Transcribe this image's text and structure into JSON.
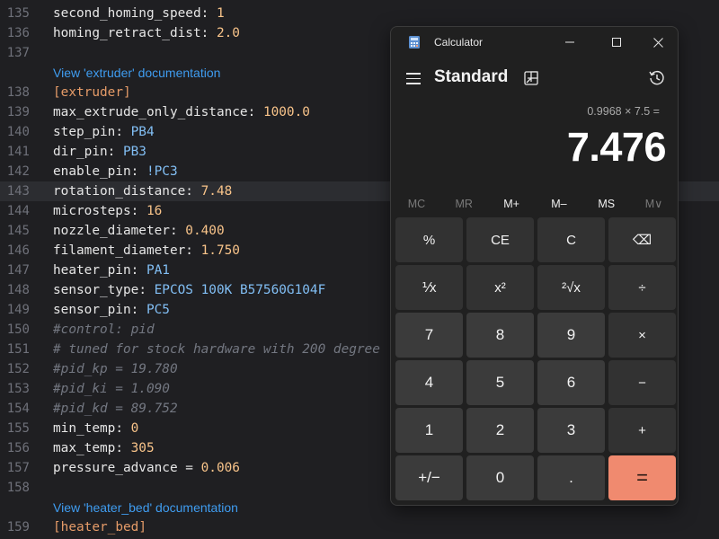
{
  "editor": {
    "lines": [
      {
        "num": "135",
        "key": "second_homing_speed",
        "sep": ": ",
        "val": "1",
        "valType": "n"
      },
      {
        "num": "136",
        "key": "homing_retract_dist",
        "sep": ": ",
        "val": "2.0",
        "valType": "n"
      },
      {
        "num": "137"
      },
      {
        "doclink": "View 'extruder' documentation"
      },
      {
        "num": "138",
        "section": "extruder"
      },
      {
        "num": "139",
        "key": "max_extrude_only_distance",
        "sep": ": ",
        "val": "1000.0",
        "valType": "n"
      },
      {
        "num": "140",
        "key": "step_pin",
        "sep": ": ",
        "val": "PB4",
        "valType": "s"
      },
      {
        "num": "141",
        "key": "dir_pin",
        "sep": ": ",
        "val": "PB3",
        "valType": "s"
      },
      {
        "num": "142",
        "key": "enable_pin",
        "sep": ": ",
        "val": "!PC3",
        "valType": "s"
      },
      {
        "num": "143",
        "key": "rotation_distance",
        "sep": ": ",
        "val": "7.48",
        "valType": "n",
        "current": true
      },
      {
        "num": "144",
        "key": "microsteps",
        "sep": ": ",
        "val": "16",
        "valType": "n"
      },
      {
        "num": "145",
        "key": "nozzle_diameter",
        "sep": ": ",
        "val": "0.400",
        "valType": "n"
      },
      {
        "num": "146",
        "key": "filament_diameter",
        "sep": ": ",
        "val": "1.750",
        "valType": "n"
      },
      {
        "num": "147",
        "key": "heater_pin",
        "sep": ": ",
        "val": "PA1",
        "valType": "s"
      },
      {
        "num": "148",
        "key": "sensor_type",
        "sep": ": ",
        "val": "EPCOS 100K B57560G104F",
        "valType": "s"
      },
      {
        "num": "149",
        "key": "sensor_pin",
        "sep": ": ",
        "val": "PC5",
        "valType": "s"
      },
      {
        "num": "150",
        "comment": "#control: pid"
      },
      {
        "num": "151",
        "comment": "# tuned for stock hardware with 200 degree"
      },
      {
        "num": "152",
        "comment": "#pid_kp = 19.780"
      },
      {
        "num": "153",
        "comment": "#pid_ki = 1.090"
      },
      {
        "num": "154",
        "comment": "#pid_kd = 89.752"
      },
      {
        "num": "155",
        "key": "min_temp",
        "sep": ": ",
        "val": "0",
        "valType": "n"
      },
      {
        "num": "156",
        "key": "max_temp",
        "sep": ": ",
        "val": "305",
        "valType": "n"
      },
      {
        "num": "157",
        "key": "pressure_advance",
        "sep": " = ",
        "val": "0.006",
        "valType": "n"
      },
      {
        "num": "158"
      },
      {
        "doclink": "View 'heater_bed' documentation"
      },
      {
        "num": "159",
        "section": "heater_bed"
      }
    ]
  },
  "calculator": {
    "title": "Calculator",
    "mode": "Standard",
    "expression": "0.9968 × 7.5 =",
    "result": "7.476",
    "memory": [
      {
        "label": "MC",
        "enabled": false
      },
      {
        "label": "MR",
        "enabled": false
      },
      {
        "label": "M+",
        "enabled": true
      },
      {
        "label": "M–",
        "enabled": true
      },
      {
        "label": "MS",
        "enabled": true
      },
      {
        "label": "M∨",
        "enabled": false
      }
    ],
    "keys": [
      [
        {
          "label": "%",
          "name": "percent"
        },
        {
          "label": "CE",
          "name": "clear-entry"
        },
        {
          "label": "C",
          "name": "clear"
        },
        {
          "label": "⌫",
          "name": "backspace"
        }
      ],
      [
        {
          "label": "⅟x",
          "name": "reciprocal"
        },
        {
          "label": "x²",
          "name": "square"
        },
        {
          "label": "²√x",
          "name": "square-root"
        },
        {
          "label": "÷",
          "name": "divide"
        }
      ],
      [
        {
          "label": "7",
          "name": "7"
        },
        {
          "label": "8",
          "name": "8"
        },
        {
          "label": "9",
          "name": "9"
        },
        {
          "label": "×",
          "name": "multiply"
        }
      ],
      [
        {
          "label": "4",
          "name": "4"
        },
        {
          "label": "5",
          "name": "5"
        },
        {
          "label": "6",
          "name": "6"
        },
        {
          "label": "−",
          "name": "subtract"
        }
      ],
      [
        {
          "label": "1",
          "name": "1"
        },
        {
          "label": "2",
          "name": "2"
        },
        {
          "label": "3",
          "name": "3"
        },
        {
          "label": "+",
          "name": "add"
        }
      ],
      [
        {
          "label": "+/−",
          "name": "negate"
        },
        {
          "label": "0",
          "name": "0"
        },
        {
          "label": ".",
          "name": "decimal"
        },
        {
          "label": "=",
          "name": "equals"
        }
      ]
    ],
    "colors": {
      "accent": "#f08a6f",
      "background": "#202020"
    }
  }
}
